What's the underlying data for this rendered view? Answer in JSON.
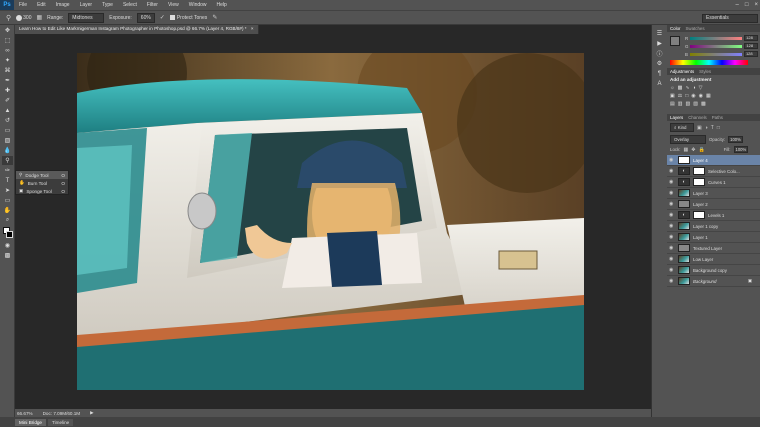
{
  "app": {
    "logo": "Ps"
  },
  "menubar": {
    "items": [
      "File",
      "Edit",
      "Image",
      "Layer",
      "Type",
      "Select",
      "Filter",
      "View",
      "Window",
      "Help"
    ],
    "window_controls": [
      "–",
      "□",
      "×"
    ]
  },
  "options": {
    "brush_size": "300",
    "range_label": "Range:",
    "range_value": "Midtones",
    "exposure_label": "Exposure:",
    "exposure_value": "60%",
    "protect_tones_label": "Protect Tones",
    "workspace": "Essentials"
  },
  "document": {
    "tab_title": "Learn How to Edit Like Markmigerman Instagram Photographer in Photoshop.psd @ 66.7% (Layer 4, RGB/8#) *",
    "zoom": "66.67%",
    "doc_info": "Doc: 7.09M/60.1M"
  },
  "flyout": {
    "items": [
      {
        "label": "Dodge Tool",
        "shortcut": "O",
        "icon": "dodge-icon"
      },
      {
        "label": "Burn Tool",
        "shortcut": "O",
        "icon": "burn-icon"
      },
      {
        "label": "Sponge Tool",
        "shortcut": "O",
        "icon": "sponge-icon"
      }
    ]
  },
  "color_panel": {
    "tabs": [
      "Color",
      "Swatches"
    ],
    "channels": [
      {
        "label": "R",
        "value": "128",
        "fraction": 0.5
      },
      {
        "label": "G",
        "value": "128",
        "fraction": 0.5
      },
      {
        "label": "B",
        "value": "128",
        "fraction": 0.5
      }
    ]
  },
  "adjustments_panel": {
    "tabs": [
      "Adjustments",
      "Styles"
    ],
    "heading": "Add an adjustment"
  },
  "layers_panel": {
    "tabs": [
      "Layers",
      "Channels",
      "Paths"
    ],
    "kind_filter": "Kind",
    "blend_mode": "Overlay",
    "opacity_label": "Opacity:",
    "opacity_value": "100%",
    "lock_label": "Lock:",
    "fill_label": "Fill:",
    "fill_value": "100%",
    "layers": [
      {
        "name": "Layer 4",
        "thumb": "white",
        "selected": true
      },
      {
        "name": "Selective Colo...",
        "thumb": "adj-white",
        "selected": false
      },
      {
        "name": "Curves 1",
        "thumb": "adj-white",
        "selected": false
      },
      {
        "name": "Layer 3",
        "thumb": "photo",
        "selected": false
      },
      {
        "name": "Layer 2",
        "thumb": "gray",
        "selected": false
      },
      {
        "name": "Levels 1",
        "thumb": "adj-white",
        "selected": false
      },
      {
        "name": "Layer 1 copy",
        "thumb": "photo",
        "selected": false
      },
      {
        "name": "Layer 1",
        "thumb": "photo",
        "selected": false
      },
      {
        "name": "Textured Layer",
        "thumb": "gray",
        "selected": false
      },
      {
        "name": "Low Layer",
        "thumb": "photo",
        "selected": false
      },
      {
        "name": "Background copy",
        "thumb": "photo",
        "selected": false
      },
      {
        "name": "Background",
        "thumb": "photo",
        "selected": false
      }
    ]
  },
  "bottom_tabs": [
    "Mini Bridge",
    "Timeline"
  ],
  "colors": {
    "ui_bg": "#535353",
    "workspace": "#282828",
    "selection": "#6a84a8",
    "truck_teal": "#2fa6a8"
  }
}
